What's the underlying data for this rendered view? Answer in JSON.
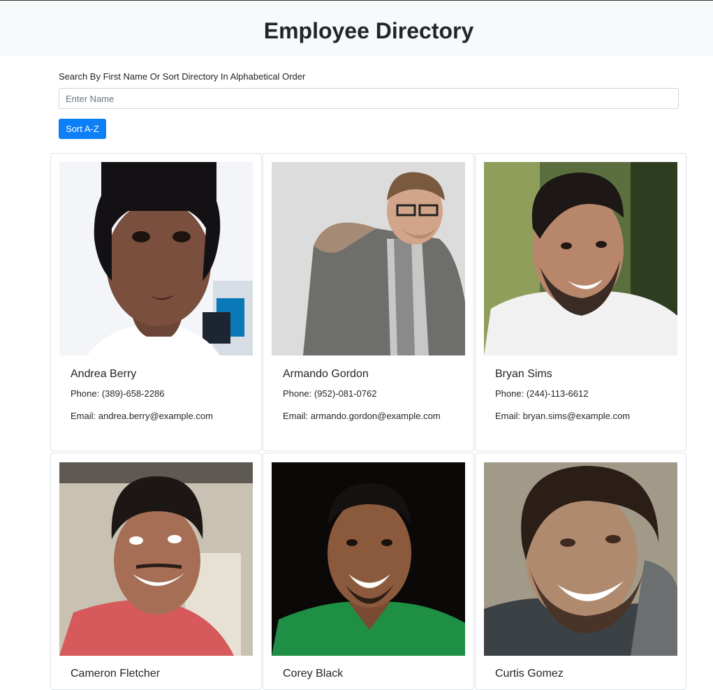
{
  "header": {
    "title": "Employee Directory"
  },
  "search": {
    "label": "Search By First Name Or Sort Directory In Alphabetical Order",
    "placeholder": "Enter Name",
    "value": ""
  },
  "sort_button": {
    "label": "Sort A-Z"
  },
  "employees": [
    {
      "name": "Andrea Berry",
      "phone": "Phone: (389)-658-2286",
      "email": "Email: andrea.berry@example.com"
    },
    {
      "name": "Armando Gordon",
      "phone": "Phone: (952)-081-0762",
      "email": "Email: armando.gordon@example.com"
    },
    {
      "name": "Bryan Sims",
      "phone": "Phone: (244)-113-6612",
      "email": "Email: bryan.sims@example.com"
    },
    {
      "name": "Cameron Fletcher",
      "phone": "",
      "email": ""
    },
    {
      "name": "Corey Black",
      "phone": "",
      "email": ""
    },
    {
      "name": "Curtis Gomez",
      "phone": "",
      "email": ""
    }
  ],
  "colors": {
    "header_bg": "#f8f9fa",
    "primary_button": "#0d7ff7",
    "card_border": "#dee2e6"
  }
}
